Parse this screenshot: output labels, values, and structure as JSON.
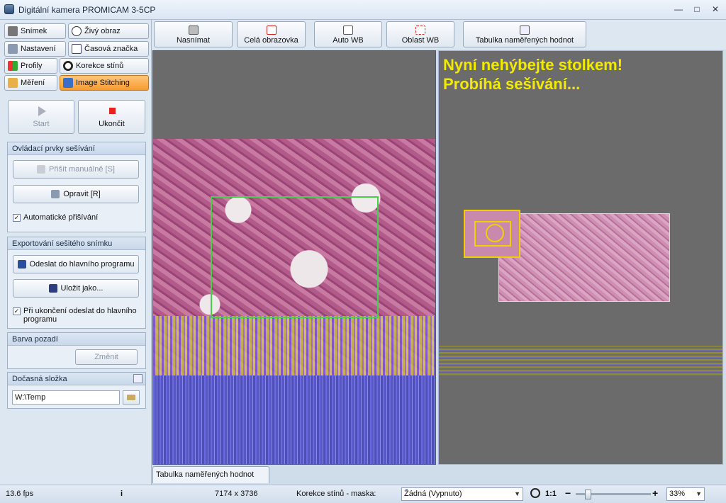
{
  "window": {
    "title": "Digitální kamera PROMICAM 3-5CP",
    "controls": [
      "—",
      "□",
      "✕"
    ]
  },
  "nav": {
    "snimek": "Snímek",
    "zivy_obraz": "Živý obraz",
    "nastaveni": "Nastavení",
    "casova_znacka": "Časová značka",
    "profily": "Profily",
    "korekce_stinu": "Korekce stínů",
    "mereni": "Měření",
    "image_stitching": "Image Stitching"
  },
  "stitching": {
    "start_label": "Start",
    "stop_label": "Ukončit",
    "controls_group": {
      "title": "Ovládací prvky sešívání",
      "manual_label": "Přišít manuálně [S]",
      "repair_label": "Opravit [R]",
      "auto_label": "Automatické přišívání"
    },
    "export_group": {
      "title": "Exportování sešitého snímku",
      "send_label": "Odeslat do hlavního programu",
      "save_label": "Uložit jako...",
      "send_on_end_label": "Při ukončení odeslat do hlavního programu"
    },
    "background_group": {
      "title": "Barva pozadí",
      "change_label": "Změnit"
    },
    "temp_group": {
      "title": "Dočasná složka",
      "path_value": "W:\\Temp"
    }
  },
  "toolbar": {
    "capture": "Nasnímat",
    "fullscreen": "Celá obrazovka",
    "auto_wb": "Auto WB",
    "area_wb": "Oblast WB",
    "table": "Tabulka naměřených hodnot"
  },
  "stitch_message": {
    "line1": "Nyní nehýbejte stolkem!",
    "line2": "Probíhá sešívání..."
  },
  "bottom_tab": "Tabulka naměřených hodnot",
  "status": {
    "fps": "13.6 fps",
    "info_icon": "i",
    "resolution": "7174 x 3736",
    "shading_label": "Korekce stínů - maska:",
    "shading_value": "Žádná (Vypnuto)",
    "ratio": "1:1",
    "zoom_minus": "−",
    "zoom_plus": "+",
    "zoom_value": "33%",
    "zoom_level": 0.33
  }
}
